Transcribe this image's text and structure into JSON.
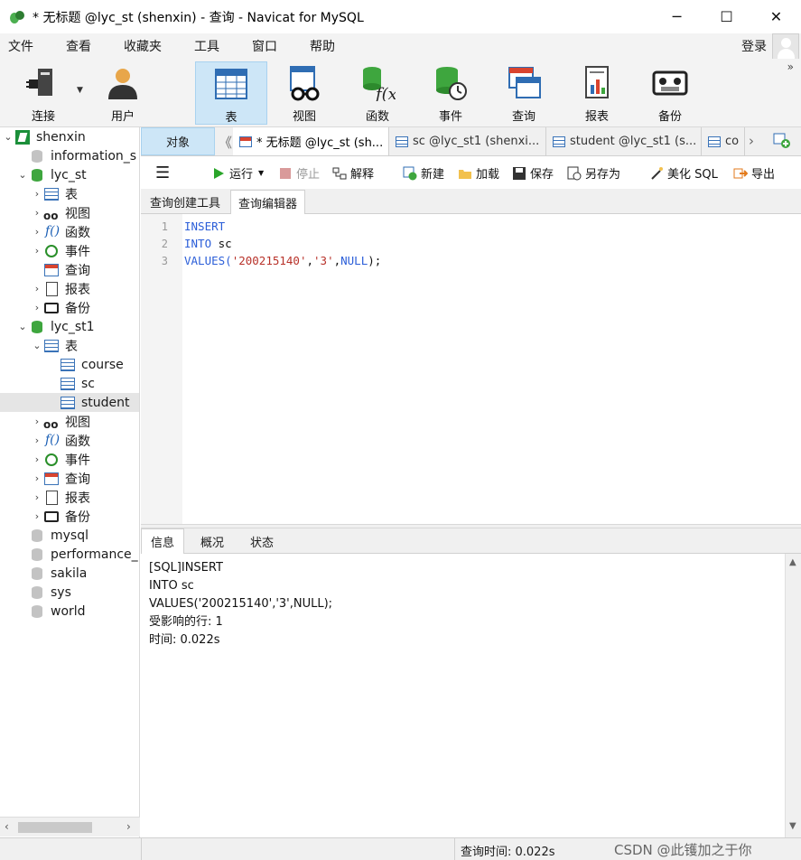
{
  "window": {
    "title": "* 无标题 @lyc_st (shenxin) - 查询 - Navicat for MySQL",
    "minimize": "─",
    "maximize": "☐",
    "close": "✕"
  },
  "menu": {
    "items": [
      "文件",
      "查看",
      "收藏夹",
      "工具",
      "窗口",
      "帮助"
    ],
    "login": "登录"
  },
  "toolbar": {
    "items": [
      {
        "label": "连接",
        "icon": "connection-icon"
      },
      {
        "label": "用户",
        "icon": "user-icon"
      },
      {
        "label": "表",
        "icon": "table-icon"
      },
      {
        "label": "视图",
        "icon": "view-icon"
      },
      {
        "label": "函数",
        "icon": "function-icon"
      },
      {
        "label": "事件",
        "icon": "event-icon"
      },
      {
        "label": "查询",
        "icon": "query-icon"
      },
      {
        "label": "报表",
        "icon": "report-icon"
      },
      {
        "label": "备份",
        "icon": "backup-icon"
      }
    ],
    "active": "表",
    "more": "»"
  },
  "sidebar": {
    "rows": [
      {
        "text": "shenxin",
        "kind": "conn"
      },
      {
        "text": "information_s",
        "kind": "db-gray"
      },
      {
        "text": "lyc_st",
        "kind": "db"
      },
      {
        "text": "表",
        "kind": "table"
      },
      {
        "text": "视图",
        "kind": "view"
      },
      {
        "text": "函数",
        "kind": "func"
      },
      {
        "text": "事件",
        "kind": "event"
      },
      {
        "text": "查询",
        "kind": "query"
      },
      {
        "text": "报表",
        "kind": "report"
      },
      {
        "text": "备份",
        "kind": "backup"
      },
      {
        "text": "lyc_st1",
        "kind": "db"
      },
      {
        "text": "表",
        "kind": "table"
      },
      {
        "text": "course",
        "kind": "table"
      },
      {
        "text": "sc",
        "kind": "table"
      },
      {
        "text": "student",
        "kind": "table"
      },
      {
        "text": "视图",
        "kind": "view"
      },
      {
        "text": "函数",
        "kind": "func"
      },
      {
        "text": "事件",
        "kind": "event"
      },
      {
        "text": "查询",
        "kind": "query"
      },
      {
        "text": "报表",
        "kind": "report"
      },
      {
        "text": "备份",
        "kind": "backup"
      },
      {
        "text": "mysql",
        "kind": "db-gray"
      },
      {
        "text": "performance_",
        "kind": "db-gray"
      },
      {
        "text": "sakila",
        "kind": "db-gray"
      },
      {
        "text": "sys",
        "kind": "db-gray"
      },
      {
        "text": "world",
        "kind": "db-gray"
      }
    ],
    "selected": "student"
  },
  "tabs": {
    "object_tab": "对象",
    "nav_left": "《",
    "nav_right": "›",
    "doc_tabs": [
      "* 无标题 @lyc_st (sh...",
      "sc @lyc_st1 (shenxi...",
      "student @lyc_st1 (s...",
      "co"
    ]
  },
  "query_toolbar": {
    "run": "运行",
    "stop": "停止",
    "explain": "解释",
    "new": "新建",
    "load": "加载",
    "save": "保存",
    "save_as": "另存为",
    "beautify": "美化 SQL",
    "export": "导出"
  },
  "sub_tabs": [
    "查询创建工具",
    "查询编辑器"
  ],
  "editor": {
    "line_numbers": [
      "1",
      "2",
      "3"
    ],
    "lines": [
      {
        "kw": "INSERT"
      },
      {
        "kw": "INTO",
        "rest": " sc"
      },
      {
        "kw": "VALUES(",
        "str1": "'200215140'",
        "sep": ",",
        "str2": "'3'",
        "sep2": ",",
        "kw2": "NULL",
        "end": ");"
      }
    ]
  },
  "result_tabs": [
    "信息",
    "概况",
    "状态"
  ],
  "result": {
    "lines": [
      "[SQL]INSERT",
      "INTO sc",
      "VALUES('200215140','3',NULL);",
      "受影响的行: 1",
      "时间: 0.022s"
    ]
  },
  "status": {
    "query_time": "查询时间: 0.022s",
    "watermark": "CSDN @此镬加之于你"
  },
  "colors": {
    "accent": "#cde6f7",
    "keyword": "#2b5ed8",
    "string": "#b8322a"
  }
}
